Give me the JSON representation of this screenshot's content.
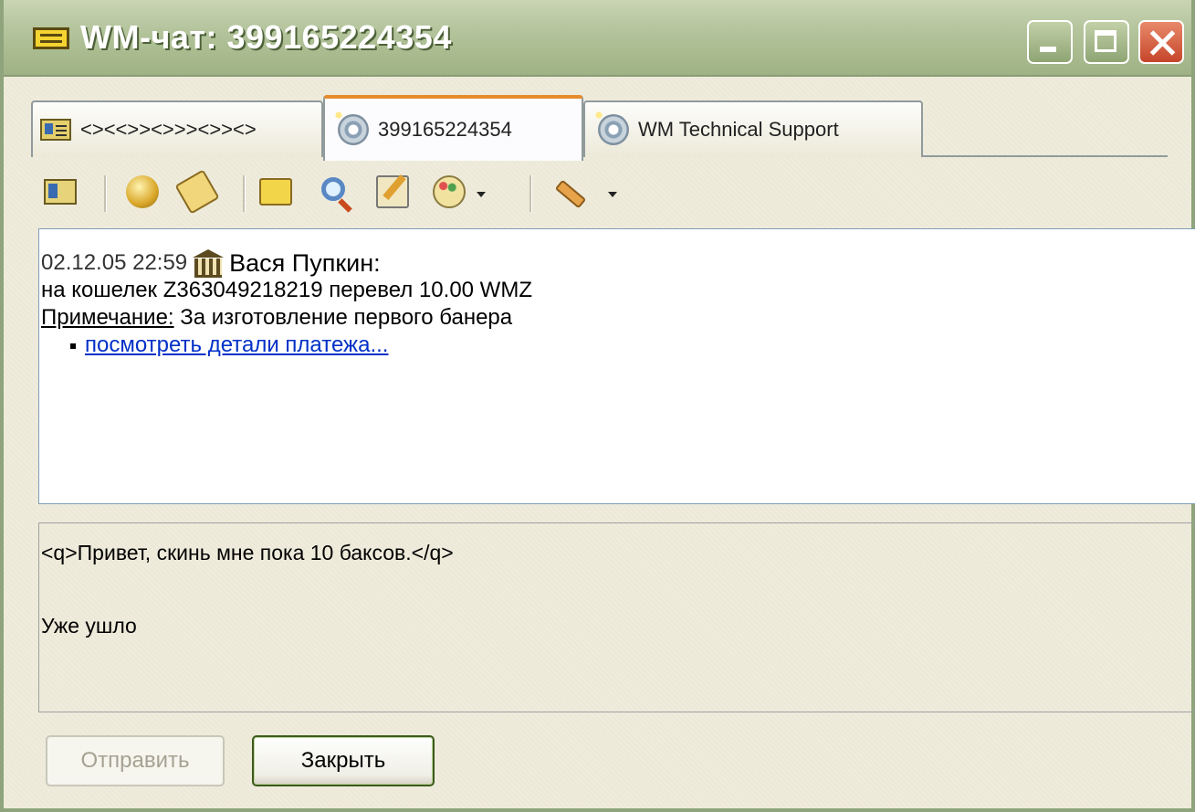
{
  "window": {
    "title": "WM-чат: 399165224354"
  },
  "tabs": [
    {
      "label": "<><<>><>>><>><>",
      "icon": "contact-card-icon",
      "active": false
    },
    {
      "label": "399165224354",
      "icon": "contact-disc-icon",
      "active": true
    },
    {
      "label": "WM Technical Support",
      "icon": "contact-disc-icon",
      "active": false
    }
  ],
  "toolbar": {
    "items": [
      "contact-card-icon",
      "coins-icon",
      "tag-icon",
      "message-icon",
      "search-icon",
      "edit-icon",
      "palette-icon",
      "wrench-icon"
    ]
  },
  "message": {
    "timestamp": "02.12.05 22:59",
    "sender": "Вася Пупкин:",
    "line1": "на кошелек Z363049218219 перевел 10.00 WMZ",
    "note_label": "Примечание:",
    "note_text": " За изготовление первого банера",
    "link": "посмотреть детали платежа..."
  },
  "input": {
    "line1": "<q>Привет, скинь мне пока 10 баксов.</q>",
    "line2": "Уже ушло"
  },
  "buttons": {
    "send": "Отправить",
    "close": "Закрыть"
  },
  "colors": {
    "titlebar": "#a9bb8f",
    "active_tab_accent": "#e68b2c",
    "link": "#0030c8",
    "close_button": "#c6452a"
  }
}
